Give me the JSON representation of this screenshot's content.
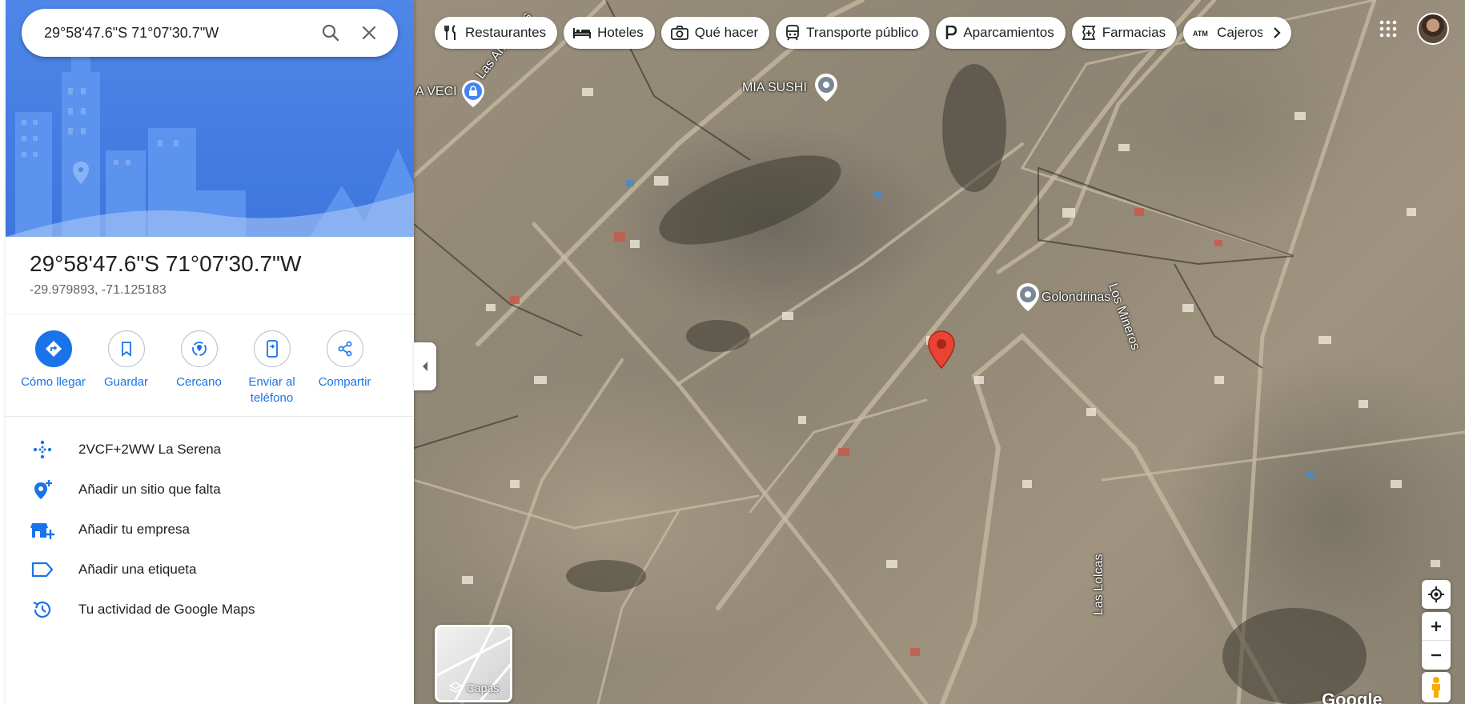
{
  "search": {
    "value": "29°58'47.6\"S 71°07'30.7\"W"
  },
  "place": {
    "title": "29°58'47.6\"S 71°07'30.7\"W",
    "decimal": "-29.979893, -71.125183"
  },
  "actions": [
    {
      "label": "Cómo llegar",
      "icon": "directions-icon"
    },
    {
      "label": "Guardar",
      "icon": "bookmark-icon"
    },
    {
      "label": "Cercano",
      "icon": "nearby-icon"
    },
    {
      "label": "Enviar al teléfono",
      "icon": "send-to-phone-icon"
    },
    {
      "label": "Compartir",
      "icon": "share-icon"
    }
  ],
  "info_list": [
    {
      "text": "2VCF+2WW La Serena",
      "icon": "plus-code-icon"
    },
    {
      "text": "Añadir un sitio que falta",
      "icon": "add-place-icon"
    },
    {
      "text": "Añadir tu empresa",
      "icon": "add-business-icon"
    },
    {
      "text": "Añadir una etiqueta",
      "icon": "label-icon"
    },
    {
      "text": "Tu actividad de Google Maps",
      "icon": "history-icon"
    }
  ],
  "chips": [
    {
      "label": "Restaurantes",
      "icon": "restaurant-icon"
    },
    {
      "label": "Hoteles",
      "icon": "hotel-icon"
    },
    {
      "label": "Qué hacer",
      "icon": "camera-icon"
    },
    {
      "label": "Transporte público",
      "icon": "transit-icon"
    },
    {
      "label": "Aparcamientos",
      "icon": "parking-icon"
    },
    {
      "label": "Farmacias",
      "icon": "pharmacy-icon"
    },
    {
      "label": "Cajeros",
      "icon": "atm-icon"
    }
  ],
  "map_labels": {
    "mia_sushi": "MIA SUSHI",
    "golondrinas": "Golondrinas",
    "los_mineros": "Los Mineros",
    "las_lolcas": "Las Lolcas",
    "las_anaucas": "Las Añañucas",
    "veci": "A VECI"
  },
  "layers_label": "Capas",
  "google_mark": "Google",
  "colors": {
    "accent": "#1a73e8",
    "pin": "#ea4335"
  }
}
